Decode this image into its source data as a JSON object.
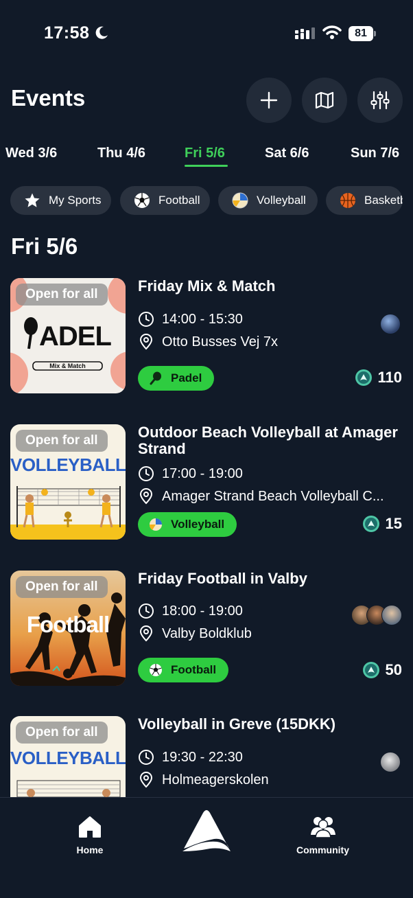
{
  "status_bar": {
    "time": "17:58",
    "battery": "81"
  },
  "header": {
    "title": "Events"
  },
  "date_tabs": [
    {
      "label": "Wed 3/6"
    },
    {
      "label": "Thu 4/6"
    },
    {
      "label": "Fri 5/6",
      "active": true
    },
    {
      "label": "Sat 6/6"
    },
    {
      "label": "Sun 7/6"
    }
  ],
  "filters": [
    {
      "label": "My Sports",
      "icon": "star-icon"
    },
    {
      "label": "Football",
      "icon": "football-icon"
    },
    {
      "label": "Volleyball",
      "icon": "volleyball-icon"
    },
    {
      "label": "Basketball",
      "icon": "basketball-icon"
    }
  ],
  "section_title": "Fri 5/6",
  "events": [
    {
      "badge": "Open for all",
      "thumb_text": "ADEL",
      "thumb_sub": "Mix & Match",
      "title": "Friday Mix & Match",
      "time": "14:00 - 15:30",
      "location": "Otto Busses Vej 7x",
      "sport": "Padel",
      "points": "110"
    },
    {
      "badge": "Open for all",
      "thumb_text": "VOLLEYBALL",
      "title": "Outdoor Beach Volleyball at Amager Strand",
      "time": "17:00 - 19:00",
      "location": "Amager Strand Beach Volleyball C...",
      "sport": "Volleyball",
      "points": "15"
    },
    {
      "badge": "Open for all",
      "thumb_text": "Football",
      "title": "Friday Football in Valby",
      "time": "18:00 - 19:00",
      "location": "Valby Boldklub",
      "sport": "Football",
      "points": "50"
    },
    {
      "badge": "Open for all",
      "thumb_text": "VOLLEYBALL",
      "title": "Volleyball in Greve (15DKK)",
      "time": "19:30 - 22:30",
      "location": "Holmeagerskolen"
    }
  ],
  "nav": {
    "home": "Home",
    "community": "Community"
  },
  "colors": {
    "background": "#111a28",
    "accent": "#3fd05a",
    "tag": "#2ecc40",
    "chip": "#2a323f"
  }
}
